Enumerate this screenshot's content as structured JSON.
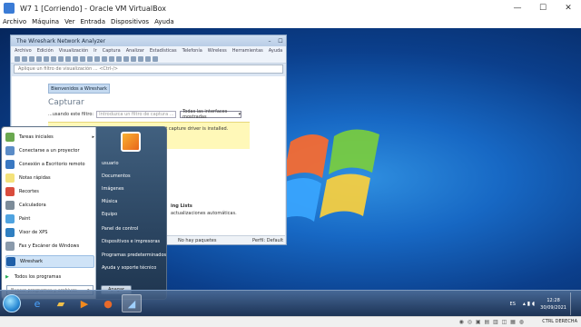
{
  "host": {
    "title": "W7 1 [Corriendo] - Oracle VM VirtualBox",
    "controls": {
      "minimize": "—",
      "maximize": "☐",
      "close": "✕"
    },
    "menu": [
      "Archivo",
      "Máquina",
      "Ver",
      "Entrada",
      "Dispositivos",
      "Ayuda"
    ],
    "hostkey_label": "CTRL DERECHA"
  },
  "wireshark": {
    "title": "The Wireshark Network Analyzer",
    "menu": [
      "Archivo",
      "Edición",
      "Visualización",
      "Ir",
      "Captura",
      "Analizar",
      "Estadísticas",
      "Telefonía",
      "Wireless",
      "Herramientas",
      "Ayuda"
    ],
    "filter_placeholder": "Aplique un filtro de visualización ... <Ctrl-/>",
    "welcome_button": "Bienvenidos a Wireshark",
    "capture_title": "Capturar",
    "capture_filter_label": "...usando este filtro:",
    "capture_filter_placeholder": "Introduzca un filtro de captura ...",
    "interfaces_select": "Todas las interfaces mostradas",
    "warning_text": "Local interfaces are unavailable because no packet capture driver is installed.",
    "learn_heading": "ing Lists",
    "learn_text": "actualizaciones automáticas.",
    "status_packets": "No hay paquetes",
    "status_profile": "Perfil: Default"
  },
  "start_menu": {
    "left_items": [
      {
        "label": "Tareas iniciales",
        "icon": "tasks-icon",
        "color": "#6aa84f",
        "has_arrow": true
      },
      {
        "label": "Conectarse a un proyector",
        "icon": "projector-icon",
        "color": "#5b8cc7",
        "has_arrow": false
      },
      {
        "label": "Conexión a Escritorio remoto",
        "icon": "remote-desktop-icon",
        "color": "#3a78c2",
        "has_arrow": false
      },
      {
        "label": "Notas rápidas",
        "icon": "sticky-notes-icon",
        "color": "#f4e27a",
        "has_arrow": false
      },
      {
        "label": "Recortes",
        "icon": "snipping-icon",
        "color": "#d94c3d",
        "has_arrow": false
      },
      {
        "label": "Calculadora",
        "icon": "calculator-icon",
        "color": "#7d8c99",
        "has_arrow": false
      },
      {
        "label": "Paint",
        "icon": "paint-icon",
        "color": "#4fa3e0",
        "has_arrow": false
      },
      {
        "label": "Visor de XPS",
        "icon": "xps-viewer-icon",
        "color": "#2f7fc1",
        "has_arrow": false
      },
      {
        "label": "Fax y Escáner de Windows",
        "icon": "fax-scanner-icon",
        "color": "#8a9aab",
        "has_arrow": false
      },
      {
        "label": "Wireshark",
        "icon": "wireshark-icon",
        "color": "#1f5fa8",
        "has_arrow": false
      }
    ],
    "all_programs": "Todos los programas",
    "search_placeholder": "Buscar programas y archivos",
    "right_items": [
      "usuario",
      "Documentos",
      "Imágenes",
      "Música",
      "Equipo",
      "Panel de control",
      "Dispositivos e impresoras",
      "Programas predeterminados",
      "Ayuda y soporte técnico"
    ],
    "shutdown_label": "Apagar"
  },
  "taskbar": {
    "language": "ES",
    "time": "12:28",
    "date": "30/09/2021"
  }
}
